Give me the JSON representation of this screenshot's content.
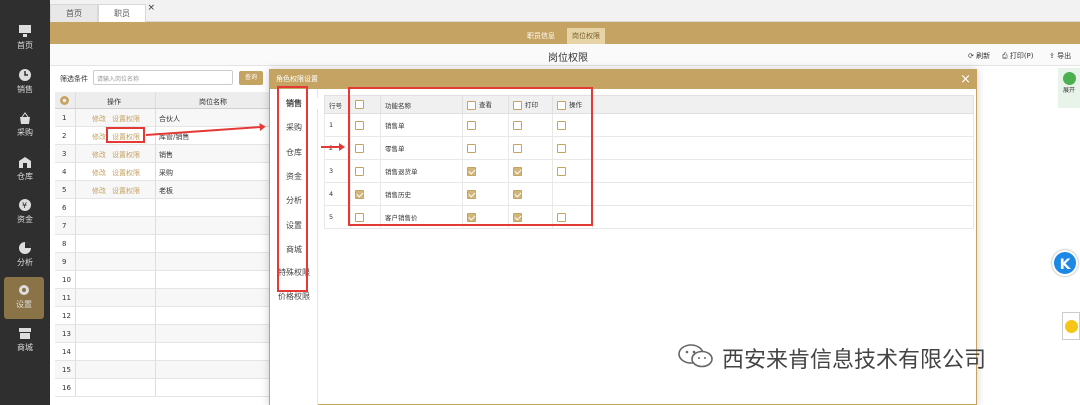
{
  "sidebar": {
    "items": [
      {
        "label": "首页",
        "icon": "monitor-icon"
      },
      {
        "label": "销售",
        "icon": "clock-icon"
      },
      {
        "label": "采购",
        "icon": "cart-icon"
      },
      {
        "label": "仓库",
        "icon": "warehouse-icon"
      },
      {
        "label": "资金",
        "icon": "money-icon"
      },
      {
        "label": "分析",
        "icon": "pie-icon"
      },
      {
        "label": "设置",
        "icon": "gear-icon"
      },
      {
        "label": "商城",
        "icon": "store-icon"
      }
    ]
  },
  "tabs": [
    {
      "label": "首页"
    },
    {
      "label": "职员"
    }
  ],
  "subtabs": [
    {
      "label": "职员信息"
    },
    {
      "label": "岗位权限"
    }
  ],
  "page": {
    "title": "岗位权限",
    "refresh": "刷新",
    "print": "打印(P)",
    "export": "导出"
  },
  "filter": {
    "label": "筛选条件",
    "placeholder": "请输入岗位名称",
    "query": "查询"
  },
  "grid": {
    "headers": [
      "操作",
      "岗位名称"
    ],
    "rows": [
      {
        "num": "1",
        "edit": "修改",
        "perm": "设置权限",
        "name": "合伙人"
      },
      {
        "num": "2",
        "edit": "修改",
        "perm": "设置权限",
        "name": "库管/销售"
      },
      {
        "num": "3",
        "edit": "修改",
        "perm": "设置权限",
        "name": "销售"
      },
      {
        "num": "4",
        "edit": "修改",
        "perm": "设置权限",
        "name": "采购"
      },
      {
        "num": "5",
        "edit": "修改",
        "perm": "设置权限",
        "name": "老板"
      },
      {
        "num": "6",
        "edit": "",
        "perm": "",
        "name": ""
      },
      {
        "num": "7",
        "edit": "",
        "perm": "",
        "name": ""
      },
      {
        "num": "8",
        "edit": "",
        "perm": "",
        "name": ""
      },
      {
        "num": "9",
        "edit": "",
        "perm": "",
        "name": ""
      },
      {
        "num": "10",
        "edit": "",
        "perm": "",
        "name": ""
      },
      {
        "num": "11",
        "edit": "",
        "perm": "",
        "name": ""
      },
      {
        "num": "12",
        "edit": "",
        "perm": "",
        "name": ""
      },
      {
        "num": "13",
        "edit": "",
        "perm": "",
        "name": ""
      },
      {
        "num": "14",
        "edit": "",
        "perm": "",
        "name": ""
      },
      {
        "num": "15",
        "edit": "",
        "perm": "",
        "name": ""
      },
      {
        "num": "16",
        "edit": "",
        "perm": "",
        "name": ""
      }
    ]
  },
  "modal": {
    "title": "角色权限设置",
    "tabs": [
      "销售",
      "采购",
      "仓库",
      "资金",
      "分析",
      "设置",
      "商城",
      "特殊权限",
      "价格权限"
    ],
    "headers": {
      "row": "行号",
      "func": "功能名称",
      "view": "查看",
      "print": "打印",
      "op": "操作"
    },
    "rows": [
      {
        "num": "1",
        "name": "销售单",
        "sel": false,
        "view": false,
        "print": false,
        "op": false,
        "hasOp": true
      },
      {
        "num": "2",
        "name": "零售单",
        "sel": false,
        "view": false,
        "print": false,
        "op": false,
        "hasOp": true
      },
      {
        "num": "3",
        "name": "销售退货单",
        "sel": false,
        "view": true,
        "print": true,
        "op": false,
        "hasOp": true
      },
      {
        "num": "4",
        "name": "销售历史",
        "sel": true,
        "view": true,
        "print": true,
        "op": false,
        "hasOp": false
      },
      {
        "num": "5",
        "name": "客户销售价",
        "sel": false,
        "view": true,
        "print": true,
        "op": false,
        "hasOp": true
      }
    ]
  },
  "right": {
    "expand": "展开",
    "badge": "K"
  },
  "watermark": "西安来肯信息技术有限公司",
  "colors": {
    "accent": "#c4a363",
    "sidebar": "#2f2f2f",
    "annotation": "#e53935"
  }
}
